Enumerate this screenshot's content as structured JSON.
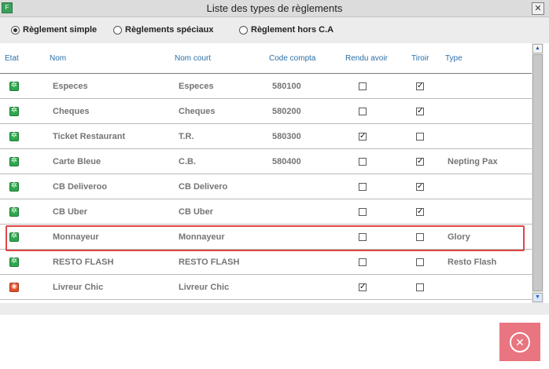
{
  "window": {
    "title": "Liste des types de règlements",
    "close_glyph": "✕",
    "app_icon_label": "F"
  },
  "radios": [
    {
      "label": "Règlement simple",
      "checked": true
    },
    {
      "label": "Règlements spéciaux",
      "checked": false
    },
    {
      "label": "Règlement hors C.A",
      "checked": false
    }
  ],
  "columns": {
    "etat": "Etat",
    "nom": "Nom",
    "nom_court": "Nom court",
    "code_compta": "Code compta",
    "rendu_avoir": "Rendu avoir",
    "tiroir": "Tiroir",
    "type": "Type"
  },
  "rows": [
    {
      "etat": "active",
      "nom": "Especes",
      "nom_court": "Especes",
      "code_compta": "580100",
      "rendu_avoir": false,
      "tiroir": true,
      "type": ""
    },
    {
      "etat": "active",
      "nom": "Cheques",
      "nom_court": "Cheques",
      "code_compta": "580200",
      "rendu_avoir": false,
      "tiroir": true,
      "type": ""
    },
    {
      "etat": "active",
      "nom": "Ticket Restaurant",
      "nom_court": "T.R.",
      "code_compta": "580300",
      "rendu_avoir": true,
      "tiroir": false,
      "type": ""
    },
    {
      "etat": "active",
      "nom": "Carte Bleue",
      "nom_court": "C.B.",
      "code_compta": "580400",
      "rendu_avoir": false,
      "tiroir": true,
      "type": "Nepting Pax"
    },
    {
      "etat": "active",
      "nom": "CB Deliveroo",
      "nom_court": "CB Delivero",
      "code_compta": "",
      "rendu_avoir": false,
      "tiroir": true,
      "type": ""
    },
    {
      "etat": "active",
      "nom": "CB Uber",
      "nom_court": "CB Uber",
      "code_compta": "",
      "rendu_avoir": false,
      "tiroir": true,
      "type": ""
    },
    {
      "etat": "active",
      "nom": "Monnayeur",
      "nom_court": "Monnayeur",
      "code_compta": "",
      "rendu_avoir": false,
      "tiroir": false,
      "type": "Glory",
      "highlighted": true
    },
    {
      "etat": "active",
      "nom": "RESTO FLASH",
      "nom_court": "RESTO FLASH",
      "code_compta": "",
      "rendu_avoir": false,
      "tiroir": false,
      "type": "Resto Flash"
    },
    {
      "etat": "inactive",
      "nom": "Livreur Chic",
      "nom_court": "Livreur Chic",
      "code_compta": "",
      "rendu_avoir": true,
      "tiroir": false,
      "type": ""
    }
  ],
  "icons": {
    "etat_active": "active-status-icon",
    "etat_inactive": "inactive-status-icon",
    "close_button": "close-circle-icon",
    "scroll_up": "arrow-up-icon",
    "scroll_down": "arrow-down-icon"
  },
  "colors": {
    "header_text": "#2c6fa6",
    "highlight": "#e04646",
    "close_button": "#e8757f",
    "status_active": "#2fa84f",
    "status_inactive": "#e0502a"
  }
}
